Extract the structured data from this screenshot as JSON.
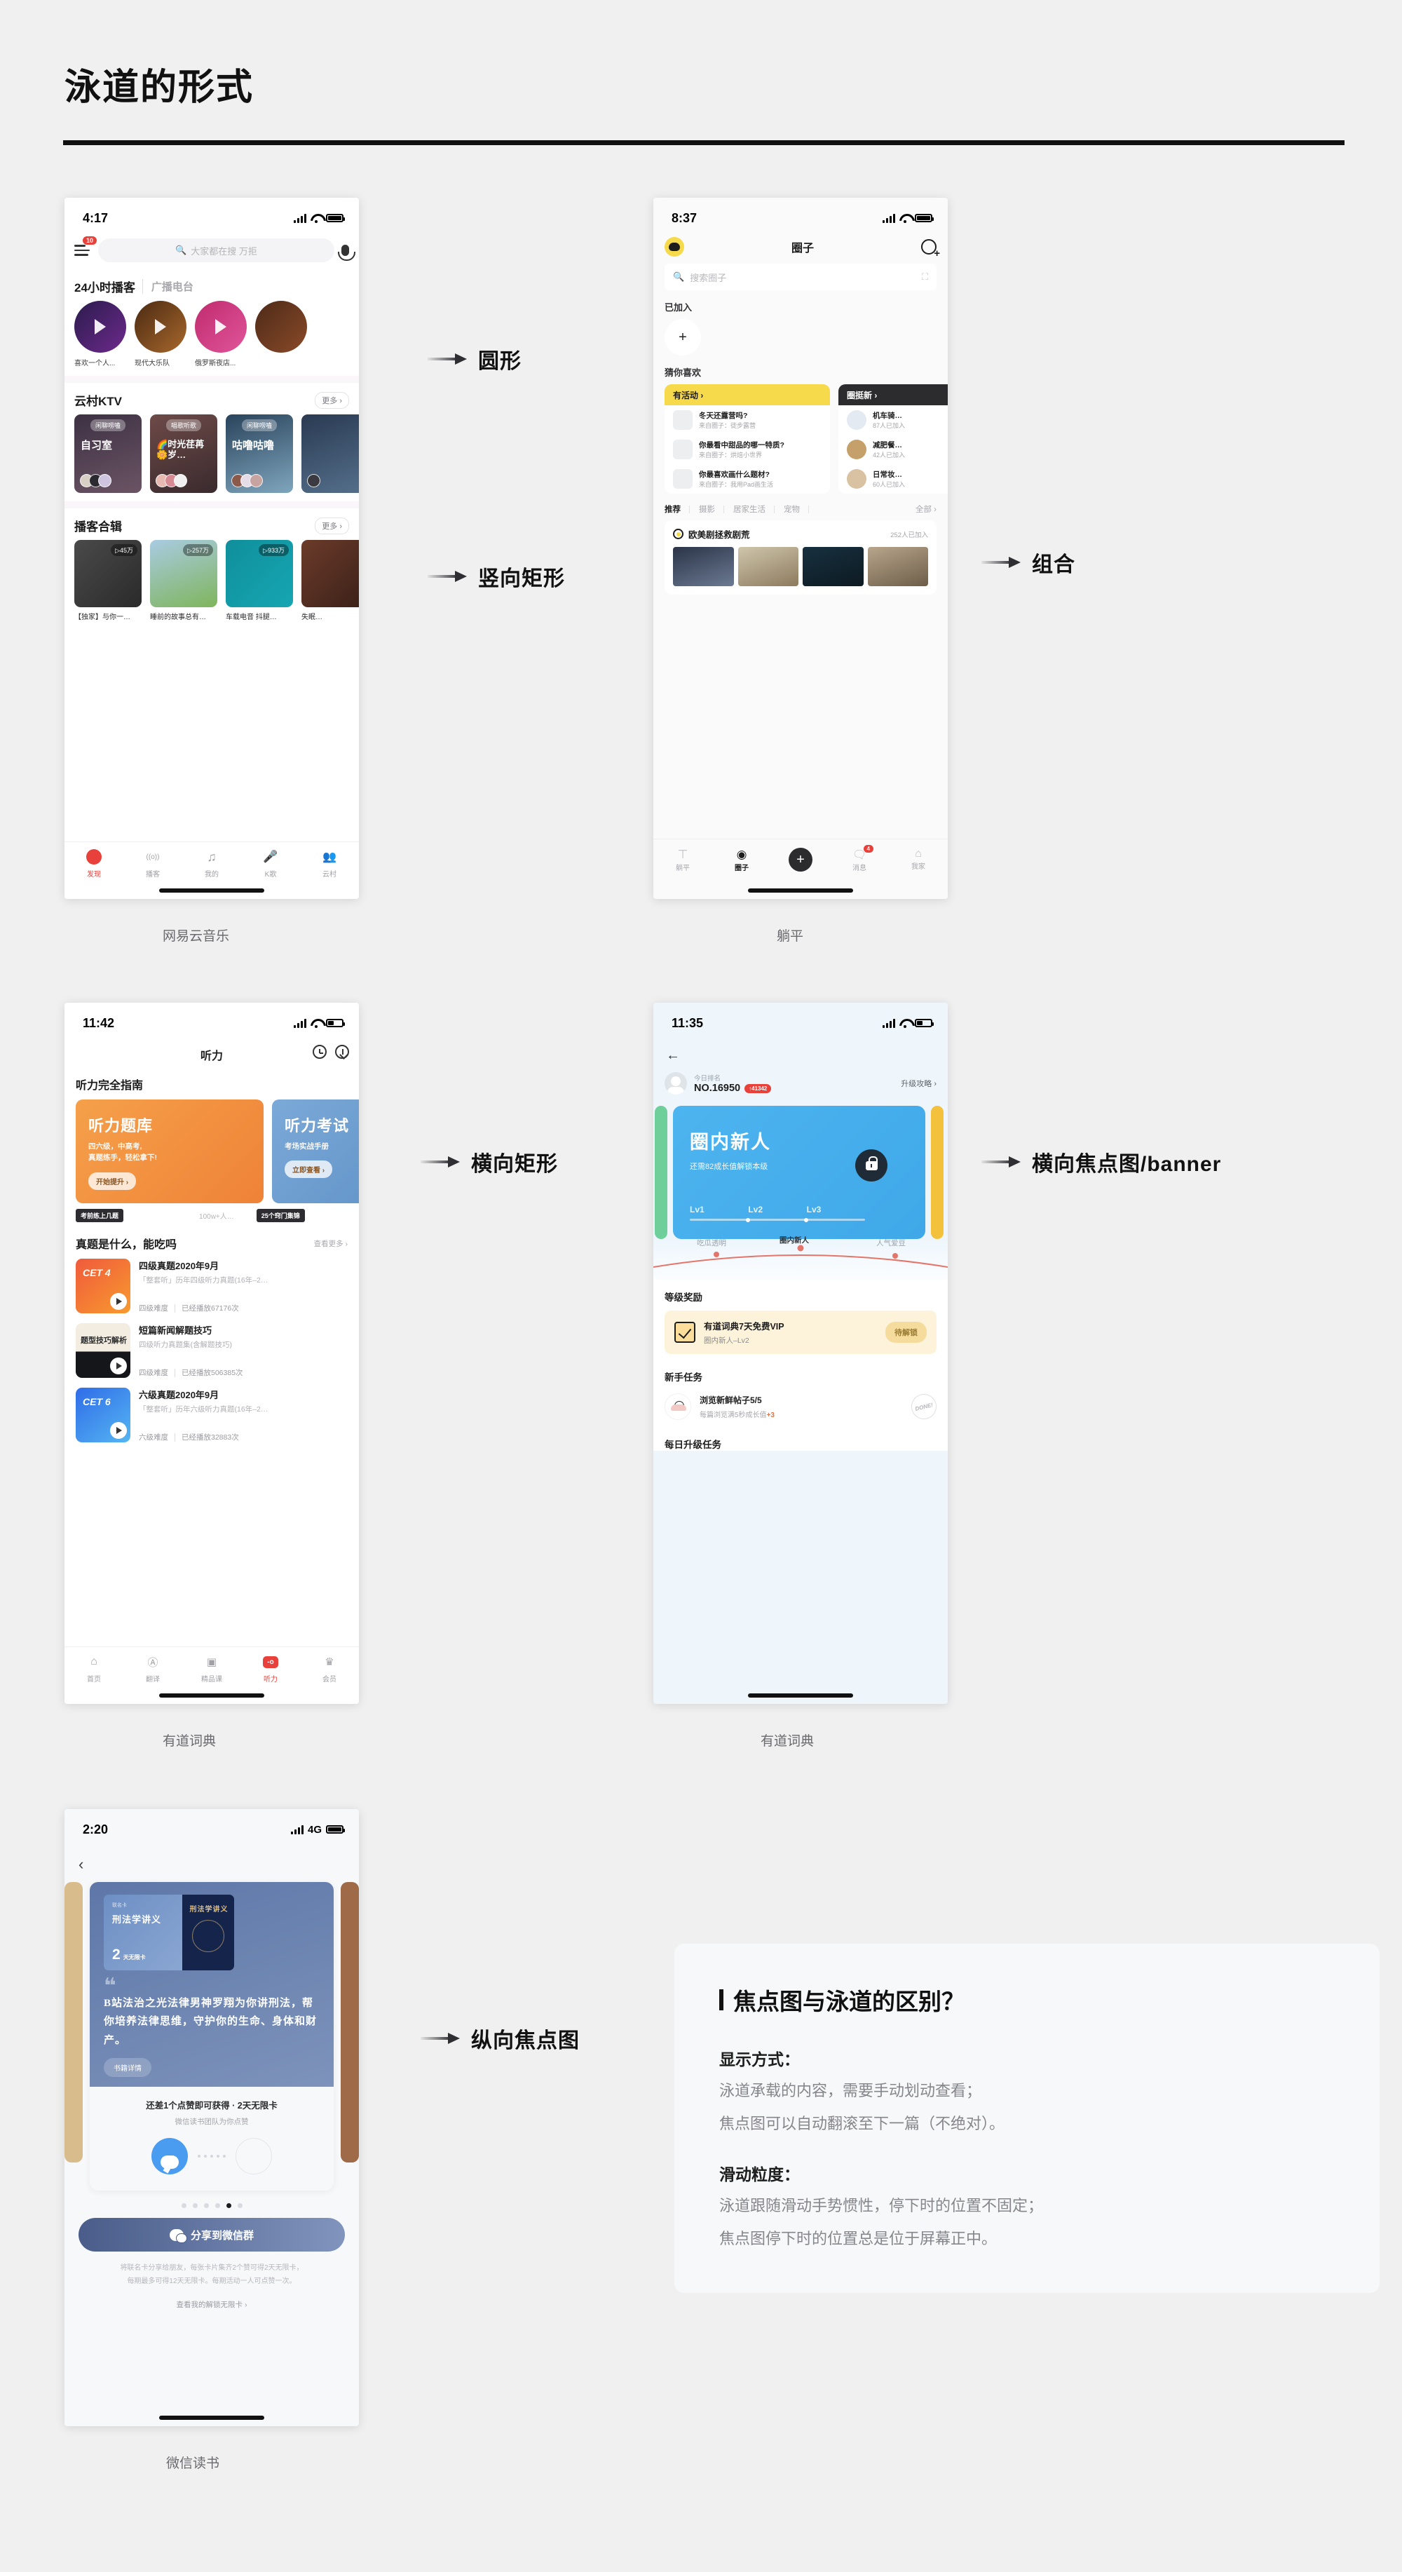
{
  "page": {
    "title": "泳道的形式"
  },
  "annotations": [
    {
      "label": "圆形"
    },
    {
      "label": "竖向矩形"
    },
    {
      "label": "组合"
    },
    {
      "label": "横向矩形"
    },
    {
      "label": "横向焦点图/banner"
    },
    {
      "label": "纵向焦点图"
    }
  ],
  "captions": {
    "netease": "网易云音乐",
    "tangping": "躺平",
    "youdao_listen": "有道词典",
    "youdao_level": "有道词典",
    "weread": "微信读书"
  },
  "phone1": {
    "status": {
      "time": "4:17"
    },
    "nav": {
      "badge": "10",
      "search_placeholder": "大家都在搜 万拒"
    },
    "section1": {
      "title": "24小时播客",
      "sub": "广播电台"
    },
    "podcasts": [
      {
        "name": "喜欢一个人...",
        "bg": "linear-gradient(135deg,#2b1b4d,#6d2a8c)"
      },
      {
        "name": "现代大乐队",
        "bg": "linear-gradient(135deg,#4a2a12,#a8682c)"
      },
      {
        "name": "俄罗斯夜店...",
        "bg": "linear-gradient(135deg,#c02b6e,#e0559a)"
      },
      {
        "name": "",
        "bg": "linear-gradient(135deg,#4d2a18,#8a4a28)"
      }
    ],
    "section2": {
      "title": "云村KTV",
      "more": "更多 ›"
    },
    "rooms": [
      {
        "tag": "闲聊唠嗑",
        "title": "自习室",
        "bg": "linear-gradient(160deg,#3d3144,#6b5464)"
      },
      {
        "tag": "唱歌听歌",
        "title": "🌈时光荏苒🌼岁…",
        "bg": "linear-gradient(160deg,#6d4a48,#3a2a2e)"
      },
      {
        "tag": "闲聊唠嗑",
        "title": "咕噜咕噜",
        "bg": "linear-gradient(160deg,#29435c,#7fa6bd)"
      },
      {
        "tag": "",
        "title": "",
        "bg": "linear-gradient(160deg,#2a3a52,#55708c)"
      }
    ],
    "section3": {
      "title": "播客合辑",
      "more": "更多 ›"
    },
    "albums": [
      {
        "plays": "▷45万",
        "caption": "【独家】与你一…",
        "bg": "linear-gradient(135deg,#4a4a4a,#2a2a2a)"
      },
      {
        "plays": "▷257万",
        "caption": "睡前的故事总有…",
        "bg": "linear-gradient(160deg,#a9cbe2,#7fb55c)"
      },
      {
        "plays": "▷933万",
        "caption": "车载电音 抖腿…",
        "bg": "linear-gradient(135deg,#0f8f9b,#16a6b3)"
      },
      {
        "plays": "",
        "caption": "失眠…",
        "bg": "linear-gradient(135deg,#6b3b2a,#3a2018)"
      }
    ],
    "tabs": [
      {
        "label": "发现",
        "icon": "netease-logo-icon",
        "active": true
      },
      {
        "label": "播客",
        "icon": "broadcast-icon",
        "active": false
      },
      {
        "label": "我的",
        "icon": "music-note-icon",
        "active": false
      },
      {
        "label": "K歌",
        "icon": "mic-icon",
        "active": false
      },
      {
        "label": "云村",
        "icon": "people-icon",
        "active": false
      }
    ]
  },
  "phone2": {
    "status": {
      "time": "8:37"
    },
    "nav": {
      "title": "圈子"
    },
    "search": {
      "placeholder": "搜索圈子"
    },
    "sections": {
      "joined": "已加入",
      "guess": "猜你喜欢"
    },
    "card_activity": {
      "header": "有活动 ›",
      "rows": [
        {
          "title": "冬天还露营吗?",
          "sub": "来自圈子：徒步露营"
        },
        {
          "title": "你最看中甜品的哪一特质?",
          "sub": "来自圈子：烘焙小世界"
        },
        {
          "title": "你最喜欢画什么题材?",
          "sub": "来自圈子：我用Pad画生活"
        }
      ]
    },
    "card_new": {
      "header": "圈挺新 ›",
      "rows": [
        {
          "title": "机车骑…",
          "sub": "87人已加入"
        },
        {
          "title": "减肥餐…",
          "sub": "42人已加入"
        },
        {
          "title": "日常妆…",
          "sub": "60人已加入"
        }
      ]
    },
    "tabs": [
      "推荐",
      "摄影",
      "居家生活",
      "宠物",
      "全部 ›"
    ],
    "feed": {
      "title": "欧美剧拯救剧荒",
      "count": "252人已加入"
    },
    "bottom_tabs": [
      {
        "label": "躺平",
        "icon": "tangping-icon",
        "active": false
      },
      {
        "label": "圈子",
        "icon": "circle-icon",
        "active": true
      },
      {
        "label": "",
        "icon": "plus-icon",
        "active": false
      },
      {
        "label": "消息",
        "icon": "message-icon",
        "active": false,
        "badge": "4"
      },
      {
        "label": "我家",
        "icon": "home-icon",
        "active": false
      }
    ]
  },
  "phone3": {
    "status": {
      "time": "11:42"
    },
    "nav": {
      "title": "听力"
    },
    "section1": {
      "title": "听力完全指南"
    },
    "banners": [
      {
        "title": "听力题库",
        "sub1": "四六级，中高考,",
        "sub2": "真题练手，轻松拿下!",
        "btn": "开始提升 ›",
        "chip": "考前练上几题",
        "count": "100w+人…"
      },
      {
        "title": "听力考试",
        "sub1": "考场实战手册",
        "sub2": "",
        "btn": "立即查看 ›",
        "chip": "25个窍门集锦",
        "count": ""
      }
    ],
    "section2": {
      "title": "真题是什么，能吃吗",
      "more": "查看更多 ›"
    },
    "items": [
      {
        "cover": "CET 4",
        "title": "四级真题2020年9月",
        "sub": "「整套听」历年四级听力真题(16年–2…",
        "level": "四级难度",
        "plays": "已经播放67176次",
        "bg": "linear-gradient(140deg,#f05a3c,#f79a2e)"
      },
      {
        "cover": "题型技巧解析",
        "title": "短篇新闻解题技巧",
        "sub": "四级听力真题集(含解题技巧)",
        "level": "四级难度",
        "plays": "已经播放506385次",
        "bg": "linear-gradient(180deg,#f2ede0 55%,#15161a 55%)"
      },
      {
        "cover": "CET 6",
        "title": "六级真题2020年9月",
        "sub": "「整套听」历年六级听力真题(16年–2…",
        "level": "六级难度",
        "plays": "已经播放32883次",
        "bg": "linear-gradient(140deg,#2f6ce8,#55b6f2)"
      }
    ],
    "tabs": [
      {
        "label": "首页",
        "icon": "home-search-icon",
        "active": false
      },
      {
        "label": "翻译",
        "icon": "translate-icon",
        "active": false
      },
      {
        "label": "精品课",
        "icon": "course-icon",
        "active": false
      },
      {
        "label": "听力",
        "icon": "listening-icon",
        "active": true
      },
      {
        "label": "会员",
        "icon": "vip-icon",
        "active": false
      }
    ]
  },
  "phone4": {
    "status": {
      "time": "11:35"
    },
    "rank": {
      "label": "今日排名",
      "value": "NO.16950",
      "up": "↑41342",
      "guide": "升级攻略 ›"
    },
    "banner": {
      "title": "圈内新人",
      "sub": "还需82成长值解锁本级",
      "levels": [
        "Lv1",
        "Lv2",
        "Lv3"
      ]
    },
    "curve": {
      "left": "吃瓜透明",
      "mid": "圈内新人",
      "right": "人气爱豆"
    },
    "reward": {
      "heading": "等级奖励",
      "title": "有道词典7天免费VIP",
      "sub": "圈内新人–Lv2",
      "status": "待解锁"
    },
    "task": {
      "heading": "新手任务",
      "title": "浏览新鲜帖子5/5",
      "sub_pre": "每篇浏览满5秒成长值",
      "sub_hl": "+3",
      "done": "DONE!"
    },
    "daily": {
      "heading": "每日升级任务"
    }
  },
  "phone5": {
    "status": {
      "time": "2:20",
      "network": "4G"
    },
    "card": {
      "badge": "联名卡",
      "book_title": "刑法学讲义",
      "days_num": "2",
      "days_unit": "天无限卡",
      "quote": "B站法治之光法律男神罗翔为你讲刑法，帮你培养法律思维，守护你的生命、身体和财产。",
      "detail_btn": "书籍详情",
      "progress_title": "还差1个点赞即可获得 · 2天无限卡",
      "progress_sub": "微信读书团队为你点赞"
    },
    "share_btn": "分享到微信群",
    "note_line1": "将联名卡分享给朋友，每张卡片集齐2个赞可得2天无限卡，",
    "note_line2": "每期最多可得12天无限卡。每期活动一人可点赞一次。",
    "link": "查看我的解锁无限卡 ›"
  },
  "info_panel": {
    "title": "焦点图与泳道的区别？",
    "sub1": "显示方式：",
    "line1": "泳道承载的内容，需要手动划动查看；",
    "line2": "焦点图可以自动翻滚至下一篇（不绝对）。",
    "sub2": "滑动粒度：",
    "line3": "泳道跟随滑动手势惯性，停下时的位置不固定；",
    "line4": "焦点图停下时的位置总是位于屏幕正中。"
  }
}
